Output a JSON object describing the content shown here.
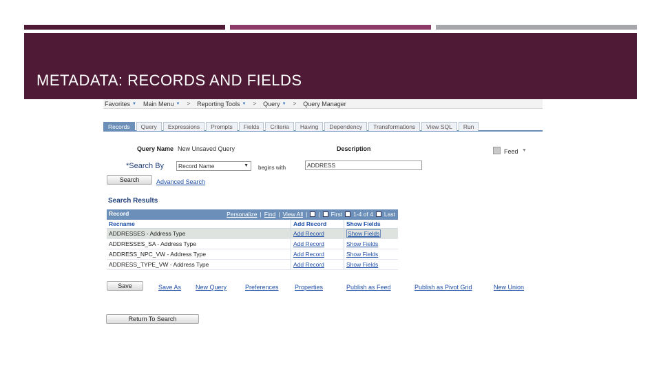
{
  "slide": {
    "title": "METADATA: RECORDS AND FIELDS",
    "colors": {
      "banner": "#4e1a35",
      "bar_mid": "#8c3a67",
      "bar_right": "#a5a7ab",
      "grid_header": "#6b8fb8",
      "link": "#1f4fa8"
    }
  },
  "breadcrumb": {
    "items": [
      "Favorites",
      "Main Menu",
      "Reporting Tools",
      "Query",
      "Query Manager"
    ]
  },
  "tabs": [
    "Records",
    "Query",
    "Expressions",
    "Prompts",
    "Fields",
    "Criteria",
    "Having",
    "Dependency",
    "Transformations",
    "View SQL",
    "Run"
  ],
  "form": {
    "query_name_label": "Query Name",
    "query_name_value": "New Unsaved Query",
    "description_label": "Description",
    "feed_label": "Feed",
    "search_by_label": "*Search By",
    "search_by_value": "Record Name",
    "operator_text": "begins with",
    "search_value": "ADDRESS",
    "search_button": "Search",
    "advanced_search_link": "Advanced Search"
  },
  "results": {
    "heading": "Search Results",
    "grid_title": "Record",
    "nav": {
      "personalize": "Personalize",
      "find": "Find",
      "view_all": "View All",
      "first": "First",
      "range": "1-4 of 4",
      "last": "Last"
    },
    "columns": [
      "Recname",
      "Add Record",
      "Show Fields"
    ],
    "rows": [
      {
        "recname": "ADDRESSES - Address Type",
        "add": "Add Record",
        "show": "Show Fields"
      },
      {
        "recname": "ADDRESSES_SA - Address Type",
        "add": "Add Record",
        "show": "Show Fields"
      },
      {
        "recname": "ADDRESS_NPC_VW - Address Type",
        "add": "Add Record",
        "show": "Show Fields"
      },
      {
        "recname": "ADDRESS_TYPE_VW - Address Type",
        "add": "Add Record",
        "show": "Show Fields"
      }
    ]
  },
  "actions": {
    "save": "Save",
    "links": [
      "Save As",
      "New Query",
      "Preferences",
      "Properties",
      "Publish as Feed",
      "Publish as Pivot Grid",
      "New Union"
    ],
    "return_to_search": "Return To Search"
  }
}
